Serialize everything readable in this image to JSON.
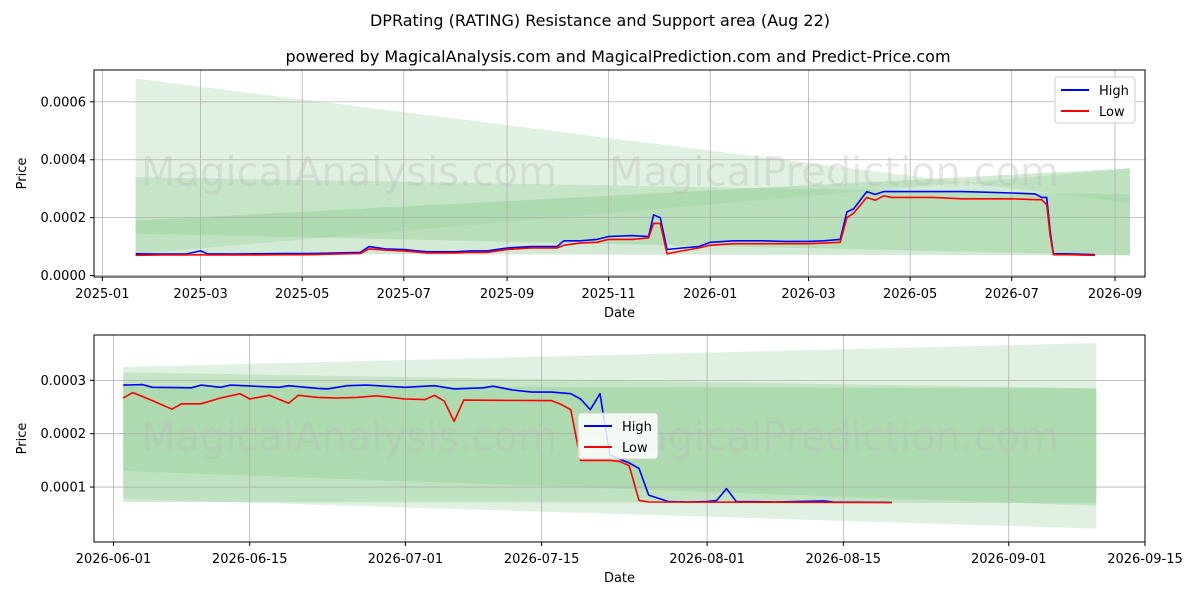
{
  "header": {
    "title": "DPRating (RATING) Resistance and Support area (Aug 22)",
    "subtitle": "powered by MagicalAnalysis.com and MagicalPrediction.com and Predict-Price.com"
  },
  "watermarks": [
    "MagicalAnalysis.com",
    "MagicalPrediction.com"
  ],
  "colors": {
    "high": "#0000ff",
    "low": "#ff0000",
    "band_light": "#c8e6c9",
    "band_mid": "#a5d6a7",
    "grid": "#b0b0b0"
  },
  "chart_data": [
    {
      "type": "line",
      "xlabel": "Date",
      "ylabel": "Price",
      "grid": true,
      "legend": "top-right",
      "x_range": [
        "2024-12-27",
        "2026-09-19"
      ],
      "ylim": [
        -5e-06,
        0.00071
      ],
      "x_ticks": [
        "2025-01",
        "2025-03",
        "2025-05",
        "2025-07",
        "2025-09",
        "2025-11",
        "2026-01",
        "2026-03",
        "2026-05",
        "2026-07",
        "2026-09"
      ],
      "x_tick_dates": [
        "2025-01-01",
        "2025-03-01",
        "2025-05-01",
        "2025-07-01",
        "2025-09-01",
        "2025-11-01",
        "2026-01-01",
        "2026-03-01",
        "2026-05-01",
        "2026-07-01",
        "2026-09-01"
      ],
      "y_ticks": [
        "0.0000",
        "0.0002",
        "0.0004",
        "0.0006"
      ],
      "y_tick_values": [
        0,
        0.0002,
        0.0004,
        0.0006
      ],
      "bands": [
        {
          "start": "2025-01-21",
          "end": "2026-09-10",
          "top": [
            0.00068,
            0.00025
          ],
          "bottom": [
            7.5e-05,
            0.00037
          ]
        },
        {
          "start": "2025-01-21",
          "end": "2026-09-10",
          "top": [
            0.00034,
            0.00028
          ],
          "bottom": [
            0.000145,
            7e-05
          ]
        },
        {
          "start": "2025-01-21",
          "end": "2026-09-10",
          "top": [
            0.00019,
            0.00037
          ],
          "bottom": [
            7.5e-05,
            7e-05
          ]
        }
      ],
      "series": [
        {
          "name": "High",
          "x": [
            "2025-01-21",
            "2025-02-05",
            "2025-02-20",
            "2025-03-01",
            "2025-03-05",
            "2025-03-20",
            "2025-04-05",
            "2025-04-20",
            "2025-05-05",
            "2025-05-20",
            "2025-06-05",
            "2025-06-10",
            "2025-06-20",
            "2025-07-01",
            "2025-07-15",
            "2025-08-01",
            "2025-08-10",
            "2025-08-20",
            "2025-09-01",
            "2025-09-15",
            "2025-10-01",
            "2025-10-05",
            "2025-10-15",
            "2025-10-25",
            "2025-11-01",
            "2025-11-15",
            "2025-11-25",
            "2025-11-28",
            "2025-12-02",
            "2025-12-06",
            "2025-12-15",
            "2025-12-25",
            "2026-01-01",
            "2026-01-15",
            "2026-02-01",
            "2026-02-15",
            "2026-03-01",
            "2026-03-10",
            "2026-03-20",
            "2026-03-24",
            "2026-03-28",
            "2026-04-05",
            "2026-04-10",
            "2026-04-15",
            "2026-04-20",
            "2026-05-01",
            "2026-05-15",
            "2026-06-01",
            "2026-06-15",
            "2026-07-01",
            "2026-07-15",
            "2026-07-19",
            "2026-07-22",
            "2026-07-24",
            "2026-07-26",
            "2026-08-03",
            "2026-08-20"
          ],
          "values": [
            7.5e-05,
            7.4e-05,
            7.4e-05,
            8.5e-05,
            7.5e-05,
            7.4e-05,
            7.5e-05,
            7.6e-05,
            7.6e-05,
            7.8e-05,
            8e-05,
            0.0001,
            9.2e-05,
            9e-05,
            8.2e-05,
            8.2e-05,
            8.5e-05,
            8.5e-05,
            9.5e-05,
            0.0001,
            0.0001,
            0.00012,
            0.00012,
            0.000125,
            0.000135,
            0.000138,
            0.000135,
            0.00021,
            0.0002,
            9e-05,
            9.5e-05,
            0.0001,
            0.000115,
            0.00012,
            0.00012,
            0.000118,
            0.000118,
            0.00012,
            0.000125,
            0.00022,
            0.00023,
            0.00029,
            0.00028,
            0.00029,
            0.00029,
            0.00029,
            0.00029,
            0.00029,
            0.000288,
            0.000285,
            0.000282,
            0.00027,
            0.00027,
            0.000155,
            7.5e-05,
            7.5e-05,
            7.2e-05
          ]
        },
        {
          "name": "Low",
          "x": [
            "2025-01-21",
            "2025-02-05",
            "2025-02-20",
            "2025-03-01",
            "2025-03-05",
            "2025-03-20",
            "2025-04-05",
            "2025-04-20",
            "2025-05-05",
            "2025-05-20",
            "2025-06-05",
            "2025-06-10",
            "2025-06-20",
            "2025-07-01",
            "2025-07-15",
            "2025-08-01",
            "2025-08-10",
            "2025-08-20",
            "2025-09-01",
            "2025-09-15",
            "2025-10-01",
            "2025-10-05",
            "2025-10-15",
            "2025-10-25",
            "2025-11-01",
            "2025-11-15",
            "2025-11-25",
            "2025-11-28",
            "2025-12-02",
            "2025-12-06",
            "2025-12-15",
            "2025-12-25",
            "2026-01-01",
            "2026-01-15",
            "2026-02-01",
            "2026-02-15",
            "2026-03-01",
            "2026-03-10",
            "2026-03-20",
            "2026-03-24",
            "2026-03-28",
            "2026-04-05",
            "2026-04-10",
            "2026-04-15",
            "2026-04-20",
            "2026-05-01",
            "2026-05-15",
            "2026-06-01",
            "2026-06-15",
            "2026-07-01",
            "2026-07-15",
            "2026-07-19",
            "2026-07-22",
            "2026-07-24",
            "2026-07-26",
            "2026-08-03",
            "2026-08-20"
          ],
          "values": [
            7e-05,
            7.1e-05,
            7.1e-05,
            7.2e-05,
            7.1e-05,
            7.1e-05,
            7.1e-05,
            7.2e-05,
            7.2e-05,
            7.4e-05,
            7.6e-05,
            9.2e-05,
            8.8e-05,
            8.5e-05,
            7.8e-05,
            7.8e-05,
            8e-05,
            8e-05,
            9e-05,
            9.5e-05,
            9.5e-05,
            0.000105,
            0.000112,
            0.000115,
            0.000125,
            0.000125,
            0.00013,
            0.00018,
            0.00018,
            7.5e-05,
            8.5e-05,
            9.5e-05,
            0.000105,
            0.00011,
            0.00011,
            0.00011,
            0.00011,
            0.000112,
            0.000115,
            0.0002,
            0.000215,
            0.00027,
            0.00026,
            0.000275,
            0.00027,
            0.00027,
            0.00027,
            0.000265,
            0.000265,
            0.000265,
            0.000262,
            0.000262,
            0.000245,
            0.00014,
            7.2e-05,
            7.2e-05,
            7e-05
          ]
        }
      ]
    },
    {
      "type": "line",
      "xlabel": "Date",
      "ylabel": "Price",
      "grid": true,
      "legend": "center",
      "x_range": [
        "2026-05-30",
        "2026-09-15"
      ],
      "ylim": [
        -3e-06,
        0.000385
      ],
      "x_ticks": [
        "2026-06-01",
        "2026-06-15",
        "2026-07-01",
        "2026-07-15",
        "2026-08-01",
        "2026-08-15",
        "2026-09-01",
        "2026-09-15"
      ],
      "x_tick_dates": [
        "2026-06-01",
        "2026-06-15",
        "2026-07-01",
        "2026-07-15",
        "2026-08-01",
        "2026-08-15",
        "2026-09-01",
        "2026-09-15"
      ],
      "y_ticks": [
        "0.0001",
        "0.0002",
        "0.0003"
      ],
      "y_tick_values": [
        0.0001,
        0.0002,
        0.0003
      ],
      "bands": [
        {
          "start": "2026-06-02",
          "end": "2026-09-10",
          "top": [
            0.000325,
            0.00037
          ],
          "bottom": [
            7.8e-05,
            2.2e-05
          ]
        },
        {
          "start": "2026-06-02",
          "end": "2026-09-10",
          "top": [
            0.000315,
            0.000285
          ],
          "bottom": [
            0.00013,
            6.5e-05
          ]
        },
        {
          "start": "2026-06-02",
          "end": "2026-09-10",
          "top": [
            0.00029,
            0.000285
          ],
          "bottom": [
            7.2e-05,
            7e-05
          ]
        }
      ],
      "series": [
        {
          "name": "High",
          "x": [
            "2026-06-02",
            "2026-06-04",
            "2026-06-05",
            "2026-06-09",
            "2026-06-10",
            "2026-06-12",
            "2026-06-13",
            "2026-06-18",
            "2026-06-19",
            "2026-06-22",
            "2026-06-23",
            "2026-06-25",
            "2026-06-27",
            "2026-07-01",
            "2026-07-03",
            "2026-07-04",
            "2026-07-06",
            "2026-07-09",
            "2026-07-10",
            "2026-07-12",
            "2026-07-14",
            "2026-07-16",
            "2026-07-18",
            "2026-07-19",
            "2026-07-20",
            "2026-07-21",
            "2026-07-22",
            "2026-07-24",
            "2026-07-25",
            "2026-07-26",
            "2026-07-28",
            "2026-07-30",
            "2026-08-01",
            "2026-08-02",
            "2026-08-03",
            "2026-08-04",
            "2026-08-08",
            "2026-08-13",
            "2026-08-14",
            "2026-08-20"
          ],
          "values": [
            0.000291,
            0.000292,
            0.000287,
            0.000286,
            0.000291,
            0.000287,
            0.000291,
            0.000287,
            0.00029,
            0.000285,
            0.000284,
            0.00029,
            0.000291,
            0.000287,
            0.000289,
            0.00029,
            0.000284,
            0.000286,
            0.000289,
            0.000282,
            0.000278,
            0.000278,
            0.000275,
            0.000265,
            0.000245,
            0.000275,
            0.00016,
            0.000145,
            0.000135,
            8.5e-05,
            7.3e-05,
            7.2e-05,
            7.3e-05,
            7.5e-05,
            9.7e-05,
            7.3e-05,
            7.2e-05,
            7.4e-05,
            7.2e-05,
            7.1e-05
          ]
        },
        {
          "name": "Low",
          "x": [
            "2026-06-02",
            "2026-06-03",
            "2026-06-05",
            "2026-06-07",
            "2026-06-08",
            "2026-06-10",
            "2026-06-12",
            "2026-06-14",
            "2026-06-15",
            "2026-06-17",
            "2026-06-19",
            "2026-06-20",
            "2026-06-22",
            "2026-06-24",
            "2026-06-26",
            "2026-06-28",
            "2026-07-01",
            "2026-07-03",
            "2026-07-04",
            "2026-07-05",
            "2026-07-06",
            "2026-07-07",
            "2026-07-15",
            "2026-07-16",
            "2026-07-17",
            "2026-07-18",
            "2026-07-19",
            "2026-07-22",
            "2026-07-23",
            "2026-07-24",
            "2026-07-25",
            "2026-07-26",
            "2026-08-20"
          ],
          "values": [
            0.000267,
            0.000277,
            0.000262,
            0.000246,
            0.000256,
            0.000256,
            0.000267,
            0.000275,
            0.000265,
            0.000272,
            0.000257,
            0.000272,
            0.000268,
            0.000267,
            0.000268,
            0.000271,
            0.000265,
            0.000264,
            0.000272,
            0.000261,
            0.000223,
            0.000263,
            0.000262,
            0.000262,
            0.000255,
            0.000245,
            0.00015,
            0.00015,
            0.000148,
            0.00014,
            7.5e-05,
            7.2e-05,
            7.1e-05
          ]
        }
      ]
    }
  ]
}
